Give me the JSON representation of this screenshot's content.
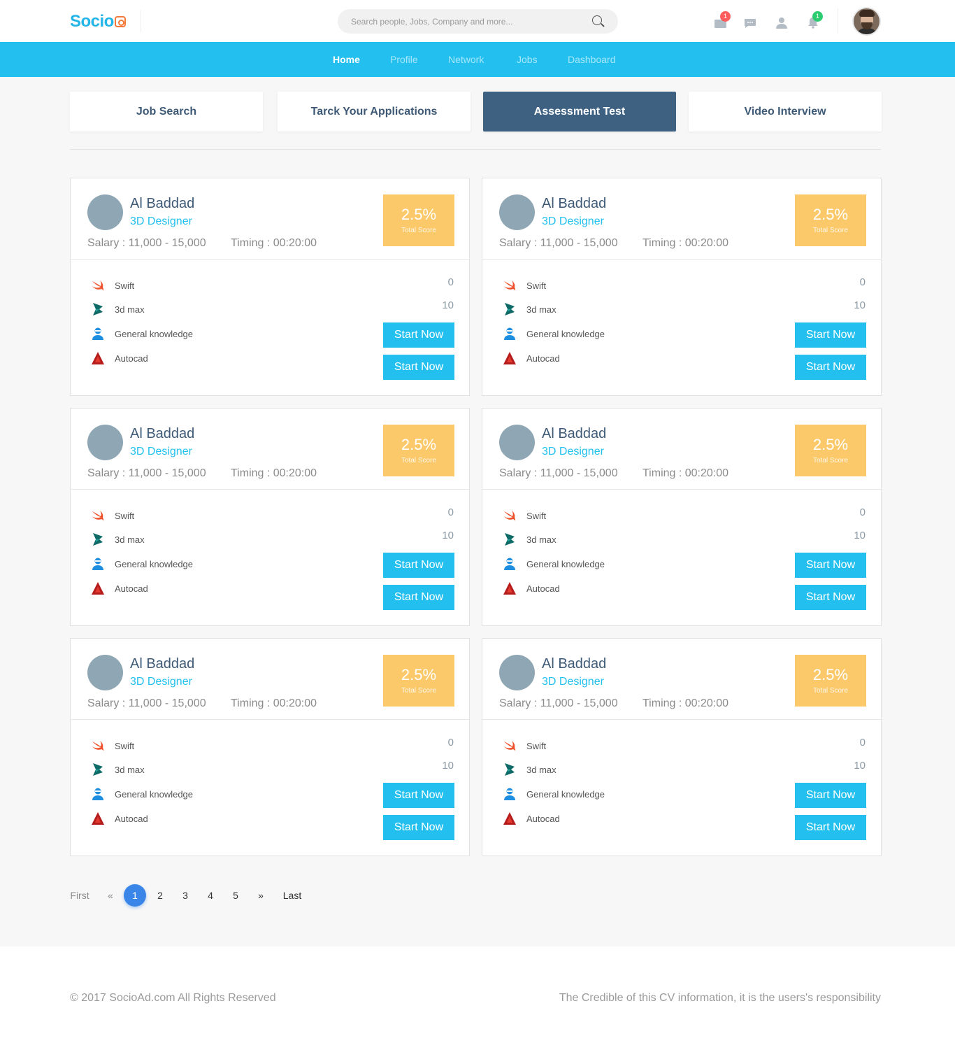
{
  "header": {
    "logo_text": "Socio",
    "search_placeholder": "Search people, Jobs, Company and more...",
    "notifications": {
      "messages_badge": "1",
      "alerts_badge": "1"
    }
  },
  "nav": {
    "items": [
      {
        "label": "Home",
        "active": true
      },
      {
        "label": "Profile"
      },
      {
        "label": "Network"
      },
      {
        "label": "Jobs"
      },
      {
        "label": "Dashboard"
      }
    ]
  },
  "tabs": [
    {
      "label": "Job Search"
    },
    {
      "label": "Tarck Your Applications"
    },
    {
      "label": "Assessment Test",
      "active": true
    },
    {
      "label": "Video Interview"
    }
  ],
  "cards": [
    {
      "name": "Al Baddad",
      "role": "3D Designer",
      "salary": "Salary : 11,000 - 15,000",
      "timing": "Timing : 00:20:00",
      "score": "2.5%",
      "score_label": "Total Score",
      "skills": [
        {
          "label": "Swift",
          "icon": "swift-icon"
        },
        {
          "label": "3d max",
          "icon": "3dmax-icon"
        },
        {
          "label": "General knowledge",
          "icon": "user-icon"
        },
        {
          "label": "Autocad",
          "icon": "autocad-icon"
        }
      ],
      "num1": "0",
      "num2": "10",
      "button1": "Start Now",
      "button2": "Start Now"
    },
    {
      "name": "Al Baddad",
      "role": "3D Designer",
      "salary": "Salary : 11,000 - 15,000",
      "timing": "Timing : 00:20:00",
      "score": "2.5%",
      "score_label": "Total Score",
      "skills": [
        {
          "label": "Swift",
          "icon": "swift-icon"
        },
        {
          "label": "3d max",
          "icon": "3dmax-icon"
        },
        {
          "label": "General knowledge",
          "icon": "user-icon"
        },
        {
          "label": "Autocad",
          "icon": "autocad-icon"
        }
      ],
      "num1": "0",
      "num2": "10",
      "button1": "Start Now",
      "button2": "Start Now"
    },
    {
      "name": "Al Baddad",
      "role": "3D Designer",
      "salary": "Salary : 11,000 - 15,000",
      "timing": "Timing : 00:20:00",
      "score": "2.5%",
      "score_label": "Total Score",
      "skills": [
        {
          "label": "Swift",
          "icon": "swift-icon"
        },
        {
          "label": "3d max",
          "icon": "3dmax-icon"
        },
        {
          "label": "General knowledge",
          "icon": "user-icon"
        },
        {
          "label": "Autocad",
          "icon": "autocad-icon"
        }
      ],
      "num1": "0",
      "num2": "10",
      "button1": "Start Now",
      "button2": "Start Now"
    },
    {
      "name": "Al Baddad",
      "role": "3D Designer",
      "salary": "Salary : 11,000 - 15,000",
      "timing": "Timing : 00:20:00",
      "score": "2.5%",
      "score_label": "Total Score",
      "skills": [
        {
          "label": "Swift",
          "icon": "swift-icon"
        },
        {
          "label": "3d max",
          "icon": "3dmax-icon"
        },
        {
          "label": "General knowledge",
          "icon": "user-icon"
        },
        {
          "label": "Autocad",
          "icon": "autocad-icon"
        }
      ],
      "num1": "0",
      "num2": "10",
      "button1": "Start Now",
      "button2": "Start Now"
    },
    {
      "name": "Al Baddad",
      "role": "3D Designer",
      "salary": "Salary : 11,000 - 15,000",
      "timing": "Timing : 00:20:00",
      "score": "2.5%",
      "score_label": "Total Score",
      "skills": [
        {
          "label": "Swift",
          "icon": "swift-icon"
        },
        {
          "label": "3d max",
          "icon": "3dmax-icon"
        },
        {
          "label": "General knowledge",
          "icon": "user-icon"
        },
        {
          "label": "Autocad",
          "icon": "autocad-icon"
        }
      ],
      "num1": "0",
      "num2": "10",
      "button1": "Start Now",
      "button2": "Start Now"
    },
    {
      "name": "Al Baddad",
      "role": "3D Designer",
      "salary": "Salary : 11,000 - 15,000",
      "timing": "Timing : 00:20:00",
      "score": "2.5%",
      "score_label": "Total Score",
      "skills": [
        {
          "label": "Swift",
          "icon": "swift-icon"
        },
        {
          "label": "3d max",
          "icon": "3dmax-icon"
        },
        {
          "label": "General knowledge",
          "icon": "user-icon"
        },
        {
          "label": "Autocad",
          "icon": "autocad-icon"
        }
      ],
      "num1": "0",
      "num2": "10",
      "button1": "Start Now",
      "button2": "Start Now"
    }
  ],
  "pagination": {
    "first": "First",
    "prev": "«",
    "pages": [
      "1",
      "2",
      "3",
      "4",
      "5"
    ],
    "current": "1",
    "next": "»",
    "last": "Last"
  },
  "footer": {
    "copyright": "© 2017 SocioAd.com All Rights Reserved",
    "disclaimer": "The Credible of this CV information, it is the users's responsibility"
  },
  "colors": {
    "primary": "#23c0ef",
    "active_tab": "#3e6182",
    "score_bg": "#fcc96a",
    "page_active": "#3a86e8"
  }
}
